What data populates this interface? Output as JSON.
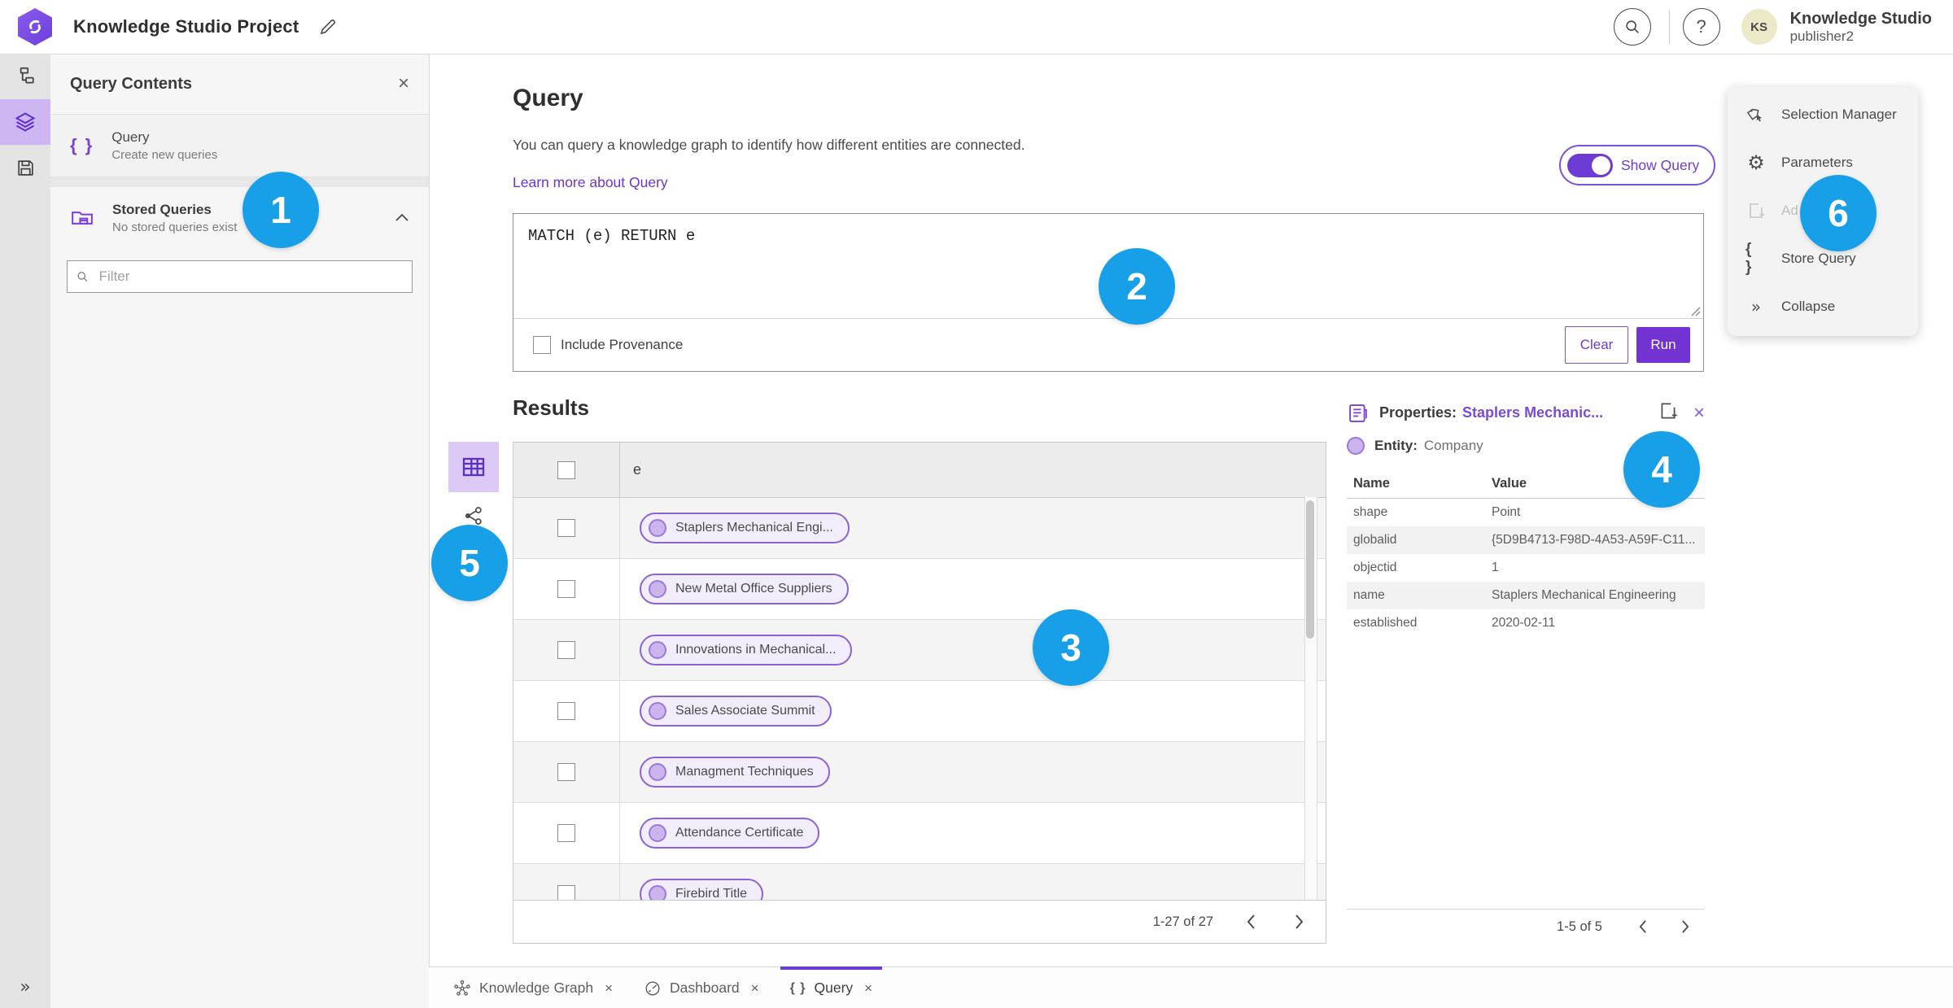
{
  "header": {
    "app_title": "Knowledge Studio Project",
    "user_name": "Knowledge Studio",
    "user_role": "publisher2",
    "avatar_initials": "KS"
  },
  "icons": {
    "close": "×",
    "braces": "{ }",
    "help": "?",
    "gear": "⚙",
    "double_chevron": "»"
  },
  "contents_panel": {
    "title": "Query Contents",
    "items": [
      {
        "label": "Query",
        "sublabel": "Create new queries"
      },
      {
        "label": "Stored Queries",
        "sublabel": "No stored queries exist"
      }
    ],
    "filter_placeholder": "Filter"
  },
  "query_section": {
    "title": "Query",
    "description": "You can query a knowledge graph to identify how different entities are connected.",
    "learn_more": "Learn more about Query",
    "show_query_label": "Show Query",
    "query_text": "MATCH (e) RETURN e",
    "include_provenance_label": "Include Provenance",
    "clear_label": "Clear",
    "run_label": "Run"
  },
  "results": {
    "title": "Results",
    "column_header": "e",
    "rows": [
      "Staplers Mechanical Engi...",
      "New Metal Office Suppliers",
      "Innovations in Mechanical...",
      "Sales Associate Summit",
      "Managment Techniques",
      "Attendance Certificate",
      "Firebird Title"
    ],
    "pagination": "1-27 of 27"
  },
  "properties_panel": {
    "title_prefix": "Properties:",
    "title_link": "Staplers Mechanic...",
    "entity_prefix": "Entity:",
    "entity_value": "Company",
    "columns": {
      "name": "Name",
      "value": "Value"
    },
    "rows": [
      {
        "name": "shape",
        "value": "Point"
      },
      {
        "name": "globalid",
        "value": "{5D9B4713-F98D-4A53-A59F-C11..."
      },
      {
        "name": "objectid",
        "value": "1"
      },
      {
        "name": "name",
        "value": "Staplers Mechanical Engineering"
      },
      {
        "name": "established",
        "value": "2020-02-11"
      }
    ],
    "pagination": "1-5 of 5"
  },
  "tools_menu": {
    "items": [
      {
        "label": "Selection Manager"
      },
      {
        "label": "Parameters"
      },
      {
        "label": "Ad"
      },
      {
        "label": "Store Query"
      },
      {
        "label": "Collapse"
      }
    ]
  },
  "bottom_tabs": [
    {
      "label": "Knowledge Graph"
    },
    {
      "label": "Dashboard"
    },
    {
      "label": "Query"
    }
  ],
  "callouts": [
    "1",
    "2",
    "3",
    "4",
    "5",
    "6"
  ],
  "colors": {
    "accent_purple": "#6e3bd4",
    "run_button_purple": "#7233d2",
    "callout_blue": "#179fe8",
    "rail_selected_bg": "#cdb6f2",
    "pill_border": "#8a63d6",
    "pill_fill": "#f2edfb"
  }
}
